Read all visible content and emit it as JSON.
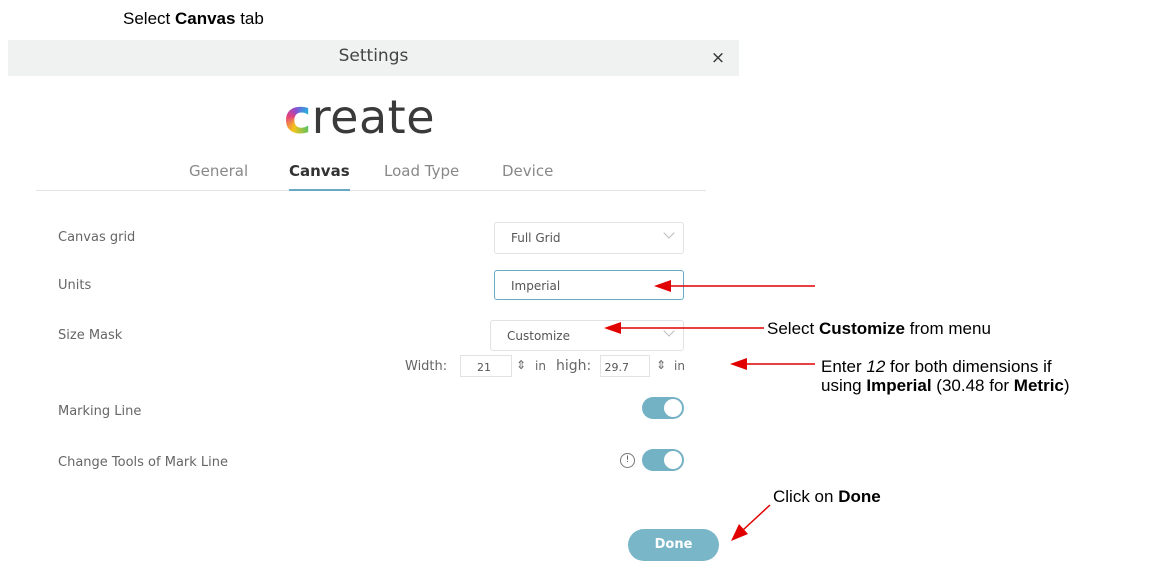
{
  "instructions": {
    "select_tab": {
      "pre": "Select ",
      "bold": "Canvas",
      "post": " tab"
    },
    "customize": {
      "pre": "Select  ",
      "bold": "Customize",
      "post": " from menu"
    },
    "enter_line1": {
      "pre": "Enter  ",
      "italic": "12",
      "post": " for both dimensions  if"
    },
    "enter_line2": {
      "pre": "using ",
      "bold1": "Imperial",
      "mid": "  (30.48 for ",
      "bold2": "Metric",
      "post": ")"
    },
    "click_done": {
      "pre": "Click on  ",
      "bold": "Done"
    }
  },
  "window": {
    "title": "Settings",
    "close_glyph": "×"
  },
  "logo": {
    "first_letter": "c",
    "rest": "reate"
  },
  "tabs": [
    {
      "label": "General",
      "active": false
    },
    {
      "label": "Canvas",
      "active": true
    },
    {
      "label": "Load Type",
      "active": false
    },
    {
      "label": "Device",
      "active": false
    }
  ],
  "settings": {
    "canvas_grid": {
      "label": "Canvas grid",
      "value": "Full Grid"
    },
    "units": {
      "label": "Units",
      "value": "Imperial"
    },
    "size_mask": {
      "label": "Size Mask",
      "value": "Customize"
    },
    "dimensions": {
      "width_label": "Width:",
      "width_value": "21",
      "width_unit": "in",
      "high_label": "high:",
      "high_value": "29.7",
      "high_unit": "in",
      "spin_glyph": "⇕"
    },
    "marking_line": {
      "label": "Marking Line",
      "on": true
    },
    "change_tools": {
      "label": "Change Tools of Mark Line",
      "on": true,
      "info_glyph": "!"
    }
  },
  "done_label": "Done",
  "colors": {
    "accent": "#73b1c5",
    "arrow": "#e00000",
    "titlebar": "#f0f1f1"
  },
  "icons": {
    "close": "close-icon",
    "chevron": "chevron-down-icon",
    "info": "info-icon",
    "spinner": "spinner-icon"
  }
}
